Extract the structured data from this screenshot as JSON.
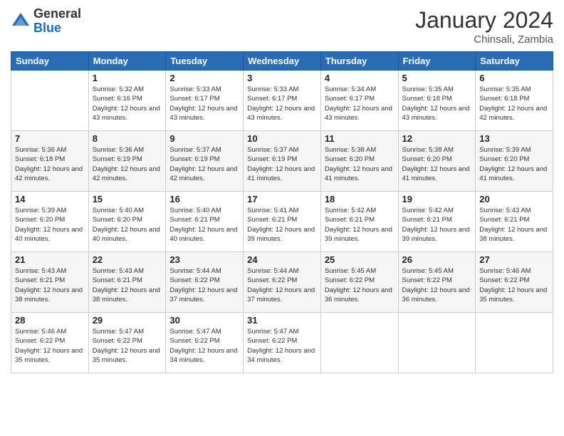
{
  "logo": {
    "general": "General",
    "blue": "Blue"
  },
  "title": "January 2024",
  "subtitle": "Chinsali, Zambia",
  "days_header": [
    "Sunday",
    "Monday",
    "Tuesday",
    "Wednesday",
    "Thursday",
    "Friday",
    "Saturday"
  ],
  "weeks": [
    [
      {
        "day": "",
        "sunrise": "",
        "sunset": "",
        "daylight": ""
      },
      {
        "day": "1",
        "sunrise": "Sunrise: 5:32 AM",
        "sunset": "Sunset: 6:16 PM",
        "daylight": "Daylight: 12 hours and 43 minutes."
      },
      {
        "day": "2",
        "sunrise": "Sunrise: 5:33 AM",
        "sunset": "Sunset: 6:17 PM",
        "daylight": "Daylight: 12 hours and 43 minutes."
      },
      {
        "day": "3",
        "sunrise": "Sunrise: 5:33 AM",
        "sunset": "Sunset: 6:17 PM",
        "daylight": "Daylight: 12 hours and 43 minutes."
      },
      {
        "day": "4",
        "sunrise": "Sunrise: 5:34 AM",
        "sunset": "Sunset: 6:17 PM",
        "daylight": "Daylight: 12 hours and 43 minutes."
      },
      {
        "day": "5",
        "sunrise": "Sunrise: 5:35 AM",
        "sunset": "Sunset: 6:18 PM",
        "daylight": "Daylight: 12 hours and 43 minutes."
      },
      {
        "day": "6",
        "sunrise": "Sunrise: 5:35 AM",
        "sunset": "Sunset: 6:18 PM",
        "daylight": "Daylight: 12 hours and 42 minutes."
      }
    ],
    [
      {
        "day": "7",
        "sunrise": "Sunrise: 5:36 AM",
        "sunset": "Sunset: 6:18 PM",
        "daylight": "Daylight: 12 hours and 42 minutes."
      },
      {
        "day": "8",
        "sunrise": "Sunrise: 5:36 AM",
        "sunset": "Sunset: 6:19 PM",
        "daylight": "Daylight: 12 hours and 42 minutes."
      },
      {
        "day": "9",
        "sunrise": "Sunrise: 5:37 AM",
        "sunset": "Sunset: 6:19 PM",
        "daylight": "Daylight: 12 hours and 42 minutes."
      },
      {
        "day": "10",
        "sunrise": "Sunrise: 5:37 AM",
        "sunset": "Sunset: 6:19 PM",
        "daylight": "Daylight: 12 hours and 41 minutes."
      },
      {
        "day": "11",
        "sunrise": "Sunrise: 5:38 AM",
        "sunset": "Sunset: 6:20 PM",
        "daylight": "Daylight: 12 hours and 41 minutes."
      },
      {
        "day": "12",
        "sunrise": "Sunrise: 5:38 AM",
        "sunset": "Sunset: 6:20 PM",
        "daylight": "Daylight: 12 hours and 41 minutes."
      },
      {
        "day": "13",
        "sunrise": "Sunrise: 5:39 AM",
        "sunset": "Sunset: 6:20 PM",
        "daylight": "Daylight: 12 hours and 41 minutes."
      }
    ],
    [
      {
        "day": "14",
        "sunrise": "Sunrise: 5:39 AM",
        "sunset": "Sunset: 6:20 PM",
        "daylight": "Daylight: 12 hours and 40 minutes."
      },
      {
        "day": "15",
        "sunrise": "Sunrise: 5:40 AM",
        "sunset": "Sunset: 6:20 PM",
        "daylight": "Daylight: 12 hours and 40 minutes."
      },
      {
        "day": "16",
        "sunrise": "Sunrise: 5:40 AM",
        "sunset": "Sunset: 6:21 PM",
        "daylight": "Daylight: 12 hours and 40 minutes."
      },
      {
        "day": "17",
        "sunrise": "Sunrise: 5:41 AM",
        "sunset": "Sunset: 6:21 PM",
        "daylight": "Daylight: 12 hours and 39 minutes."
      },
      {
        "day": "18",
        "sunrise": "Sunrise: 5:42 AM",
        "sunset": "Sunset: 6:21 PM",
        "daylight": "Daylight: 12 hours and 39 minutes."
      },
      {
        "day": "19",
        "sunrise": "Sunrise: 5:42 AM",
        "sunset": "Sunset: 6:21 PM",
        "daylight": "Daylight: 12 hours and 39 minutes."
      },
      {
        "day": "20",
        "sunrise": "Sunrise: 5:43 AM",
        "sunset": "Sunset: 6:21 PM",
        "daylight": "Daylight: 12 hours and 38 minutes."
      }
    ],
    [
      {
        "day": "21",
        "sunrise": "Sunrise: 5:43 AM",
        "sunset": "Sunset: 6:21 PM",
        "daylight": "Daylight: 12 hours and 38 minutes."
      },
      {
        "day": "22",
        "sunrise": "Sunrise: 5:43 AM",
        "sunset": "Sunset: 6:21 PM",
        "daylight": "Daylight: 12 hours and 38 minutes."
      },
      {
        "day": "23",
        "sunrise": "Sunrise: 5:44 AM",
        "sunset": "Sunset: 6:22 PM",
        "daylight": "Daylight: 12 hours and 37 minutes."
      },
      {
        "day": "24",
        "sunrise": "Sunrise: 5:44 AM",
        "sunset": "Sunset: 6:22 PM",
        "daylight": "Daylight: 12 hours and 37 minutes."
      },
      {
        "day": "25",
        "sunrise": "Sunrise: 5:45 AM",
        "sunset": "Sunset: 6:22 PM",
        "daylight": "Daylight: 12 hours and 36 minutes."
      },
      {
        "day": "26",
        "sunrise": "Sunrise: 5:45 AM",
        "sunset": "Sunset: 6:22 PM",
        "daylight": "Daylight: 12 hours and 36 minutes."
      },
      {
        "day": "27",
        "sunrise": "Sunrise: 5:46 AM",
        "sunset": "Sunset: 6:22 PM",
        "daylight": "Daylight: 12 hours and 35 minutes."
      }
    ],
    [
      {
        "day": "28",
        "sunrise": "Sunrise: 5:46 AM",
        "sunset": "Sunset: 6:22 PM",
        "daylight": "Daylight: 12 hours and 35 minutes."
      },
      {
        "day": "29",
        "sunrise": "Sunrise: 5:47 AM",
        "sunset": "Sunset: 6:22 PM",
        "daylight": "Daylight: 12 hours and 35 minutes."
      },
      {
        "day": "30",
        "sunrise": "Sunrise: 5:47 AM",
        "sunset": "Sunset: 6:22 PM",
        "daylight": "Daylight: 12 hours and 34 minutes."
      },
      {
        "day": "31",
        "sunrise": "Sunrise: 5:47 AM",
        "sunset": "Sunset: 6:22 PM",
        "daylight": "Daylight: 12 hours and 34 minutes."
      },
      {
        "day": "",
        "sunrise": "",
        "sunset": "",
        "daylight": ""
      },
      {
        "day": "",
        "sunrise": "",
        "sunset": "",
        "daylight": ""
      },
      {
        "day": "",
        "sunrise": "",
        "sunset": "",
        "daylight": ""
      }
    ]
  ]
}
